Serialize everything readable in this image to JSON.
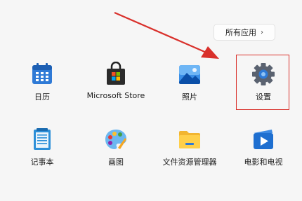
{
  "all_apps": {
    "label": "所有应用",
    "chevron": "›",
    "icon": "chevron-right-icon"
  },
  "apps": [
    {
      "name": "日历",
      "icon": "calendar-icon"
    },
    {
      "name": "Microsoft Store",
      "icon": "store-icon"
    },
    {
      "name": "照片",
      "icon": "photos-icon"
    },
    {
      "name": "设置",
      "icon": "settings-gear-icon"
    },
    {
      "name": "记事本",
      "icon": "notepad-icon"
    },
    {
      "name": "画图",
      "icon": "paint-icon"
    },
    {
      "name": "文件资源管理器",
      "icon": "folder-icon"
    },
    {
      "name": "电影和电视",
      "icon": "movies-icon"
    }
  ],
  "annotation": {
    "highlight_color": "#d9302b",
    "target": "设置"
  }
}
